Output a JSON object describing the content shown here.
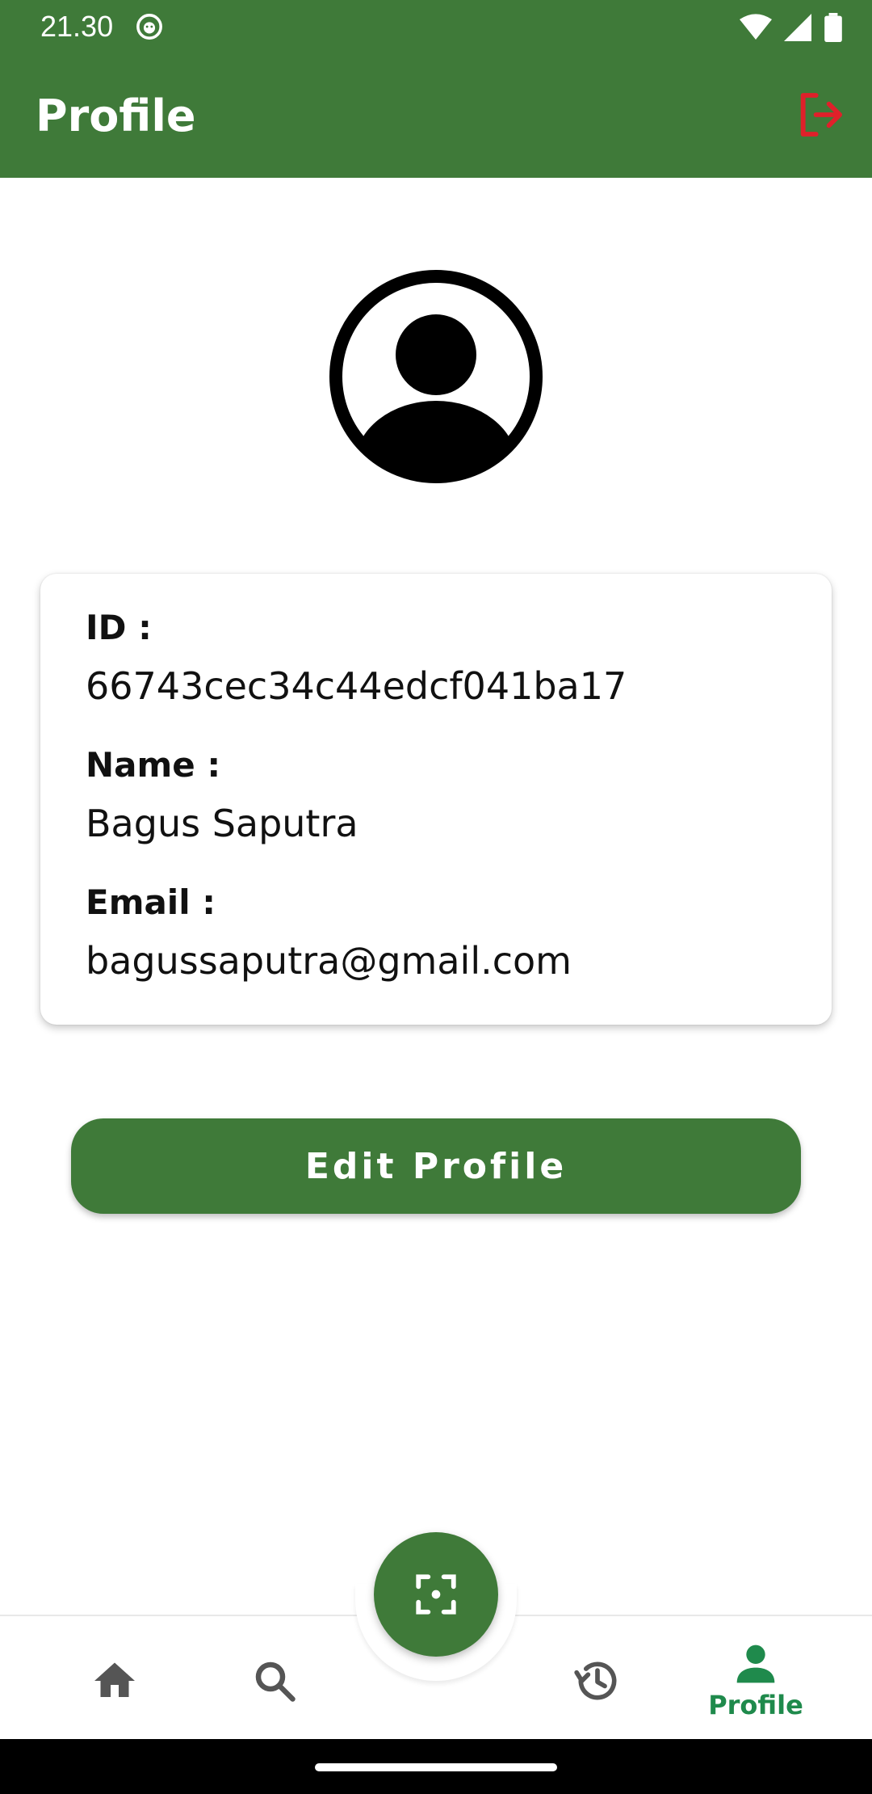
{
  "status_bar": {
    "time": "21.30",
    "icons": [
      "app-notification-icon",
      "wifi-icon",
      "signal-icon",
      "battery-icon"
    ]
  },
  "app_bar": {
    "title": "Profile",
    "action_icon": "logout-icon",
    "action_color": "#e0202a"
  },
  "profile": {
    "avatar_icon": "account-circle-icon",
    "id_label": "ID :",
    "id_value": "66743cec34c44edcf041ba17",
    "name_label": "Name :",
    "name_value": "Bagus Saputra",
    "email_label": "Email :",
    "email_value": "bagussaputra@gmail.com"
  },
  "edit_button": {
    "label": "Edit Profile"
  },
  "bottom_nav": {
    "items": [
      {
        "icon": "home-icon",
        "label": ""
      },
      {
        "icon": "search-icon",
        "label": ""
      },
      {
        "icon": "history-icon",
        "label": ""
      },
      {
        "icon": "person-icon",
        "label": "Profile",
        "active": true
      }
    ],
    "fab_icon": "scan-icon",
    "active_color": "#1f8a4c",
    "inactive_color": "#555555"
  },
  "colors": {
    "primary": "#3f7a39",
    "background": "#ffffff"
  }
}
